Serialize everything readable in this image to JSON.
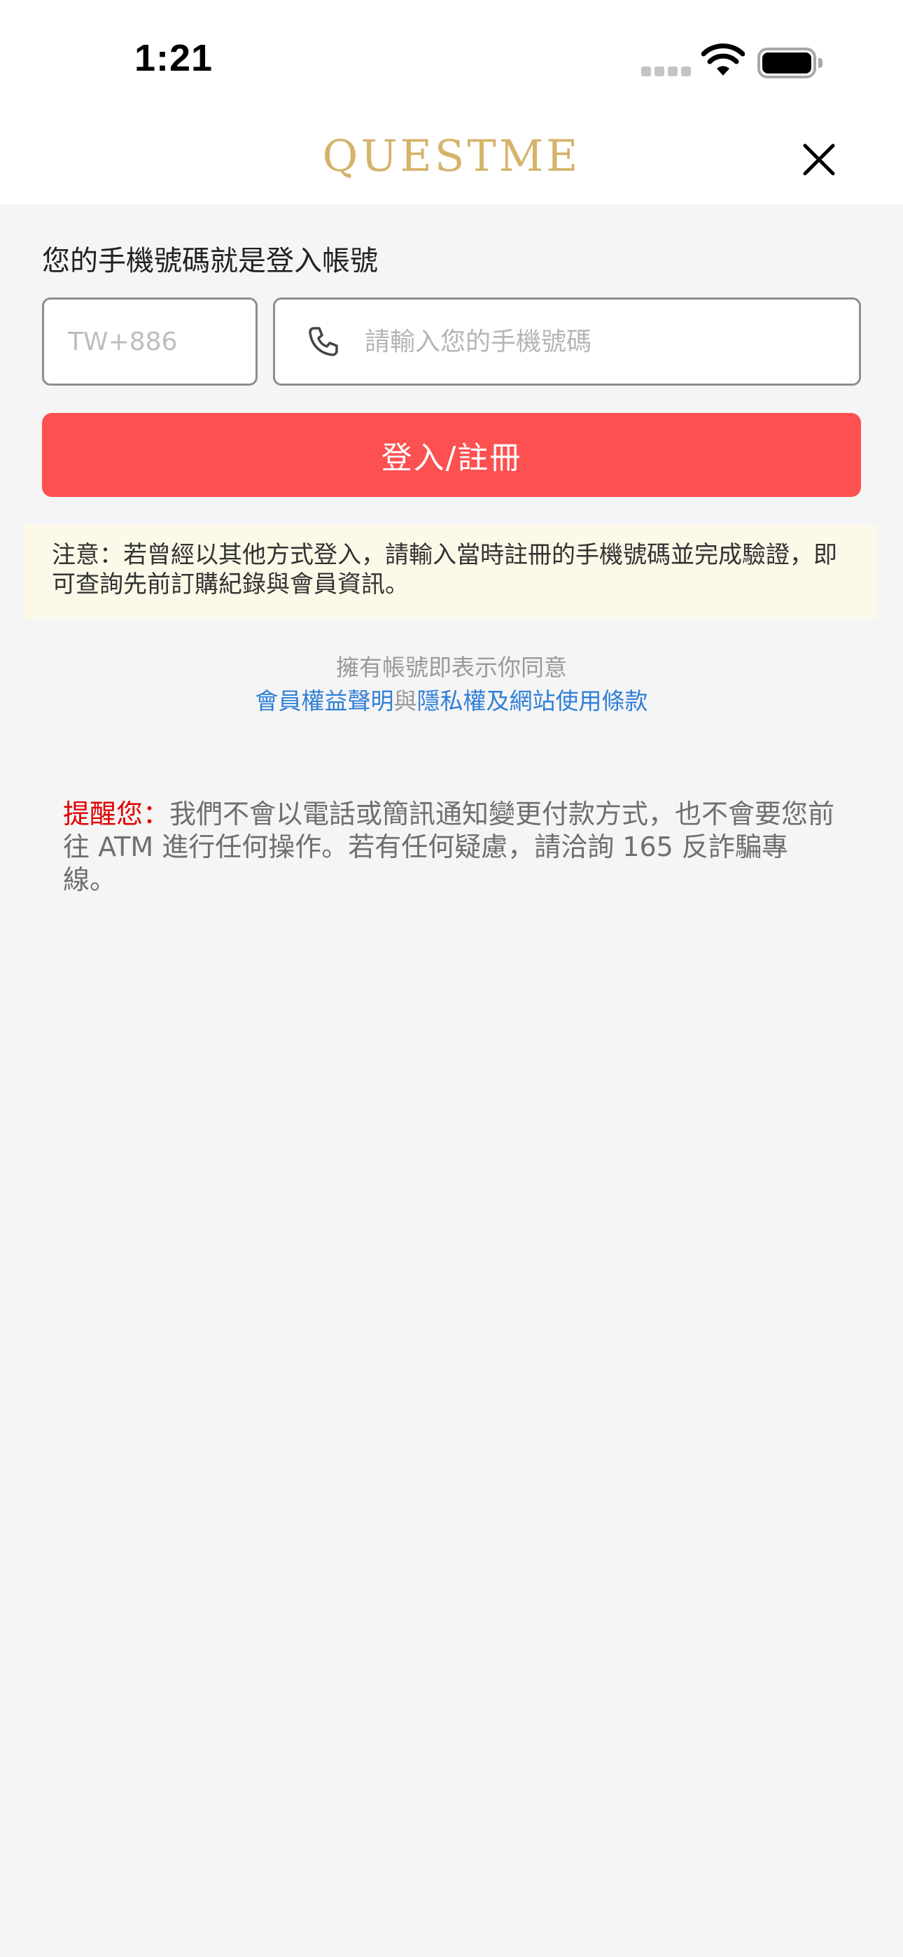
{
  "status_bar": {
    "time": "1:21"
  },
  "header": {
    "brand": "QUESTME"
  },
  "login": {
    "label": "您的手機號碼就是登入帳號",
    "country_code_placeholder": "TW+886",
    "phone_placeholder": "請輸入您的手機號碼",
    "submit_label": "登入/註冊"
  },
  "notice": {
    "text": "注意：若曾經以其他方式登入，請輸入當時註冊的手機號碼並完成驗證，即可查詢先前訂購紀錄與會員資訊。"
  },
  "agreement": {
    "intro": "擁有帳號即表示你同意",
    "link1": "會員權益聲明",
    "connector": "與",
    "link2": "隱私權及網站使用條款"
  },
  "reminder": {
    "prefix": "提醒您：",
    "text": "我們不會以電話或簡訊通知變更付款方式，也不會要您前往 ATM 進行任何操作。若有任何疑慮，請洽詢 165 反詐騙專線。"
  },
  "colors": {
    "brand": "#d4b46a",
    "primary_button": "#fd5050",
    "link": "#2f7fd8",
    "warning": "#e00000",
    "notice_background": "#fcf9e8"
  },
  "icons": [
    "signal-icon",
    "wifi-icon",
    "battery-icon",
    "close-icon",
    "phone-icon"
  ]
}
